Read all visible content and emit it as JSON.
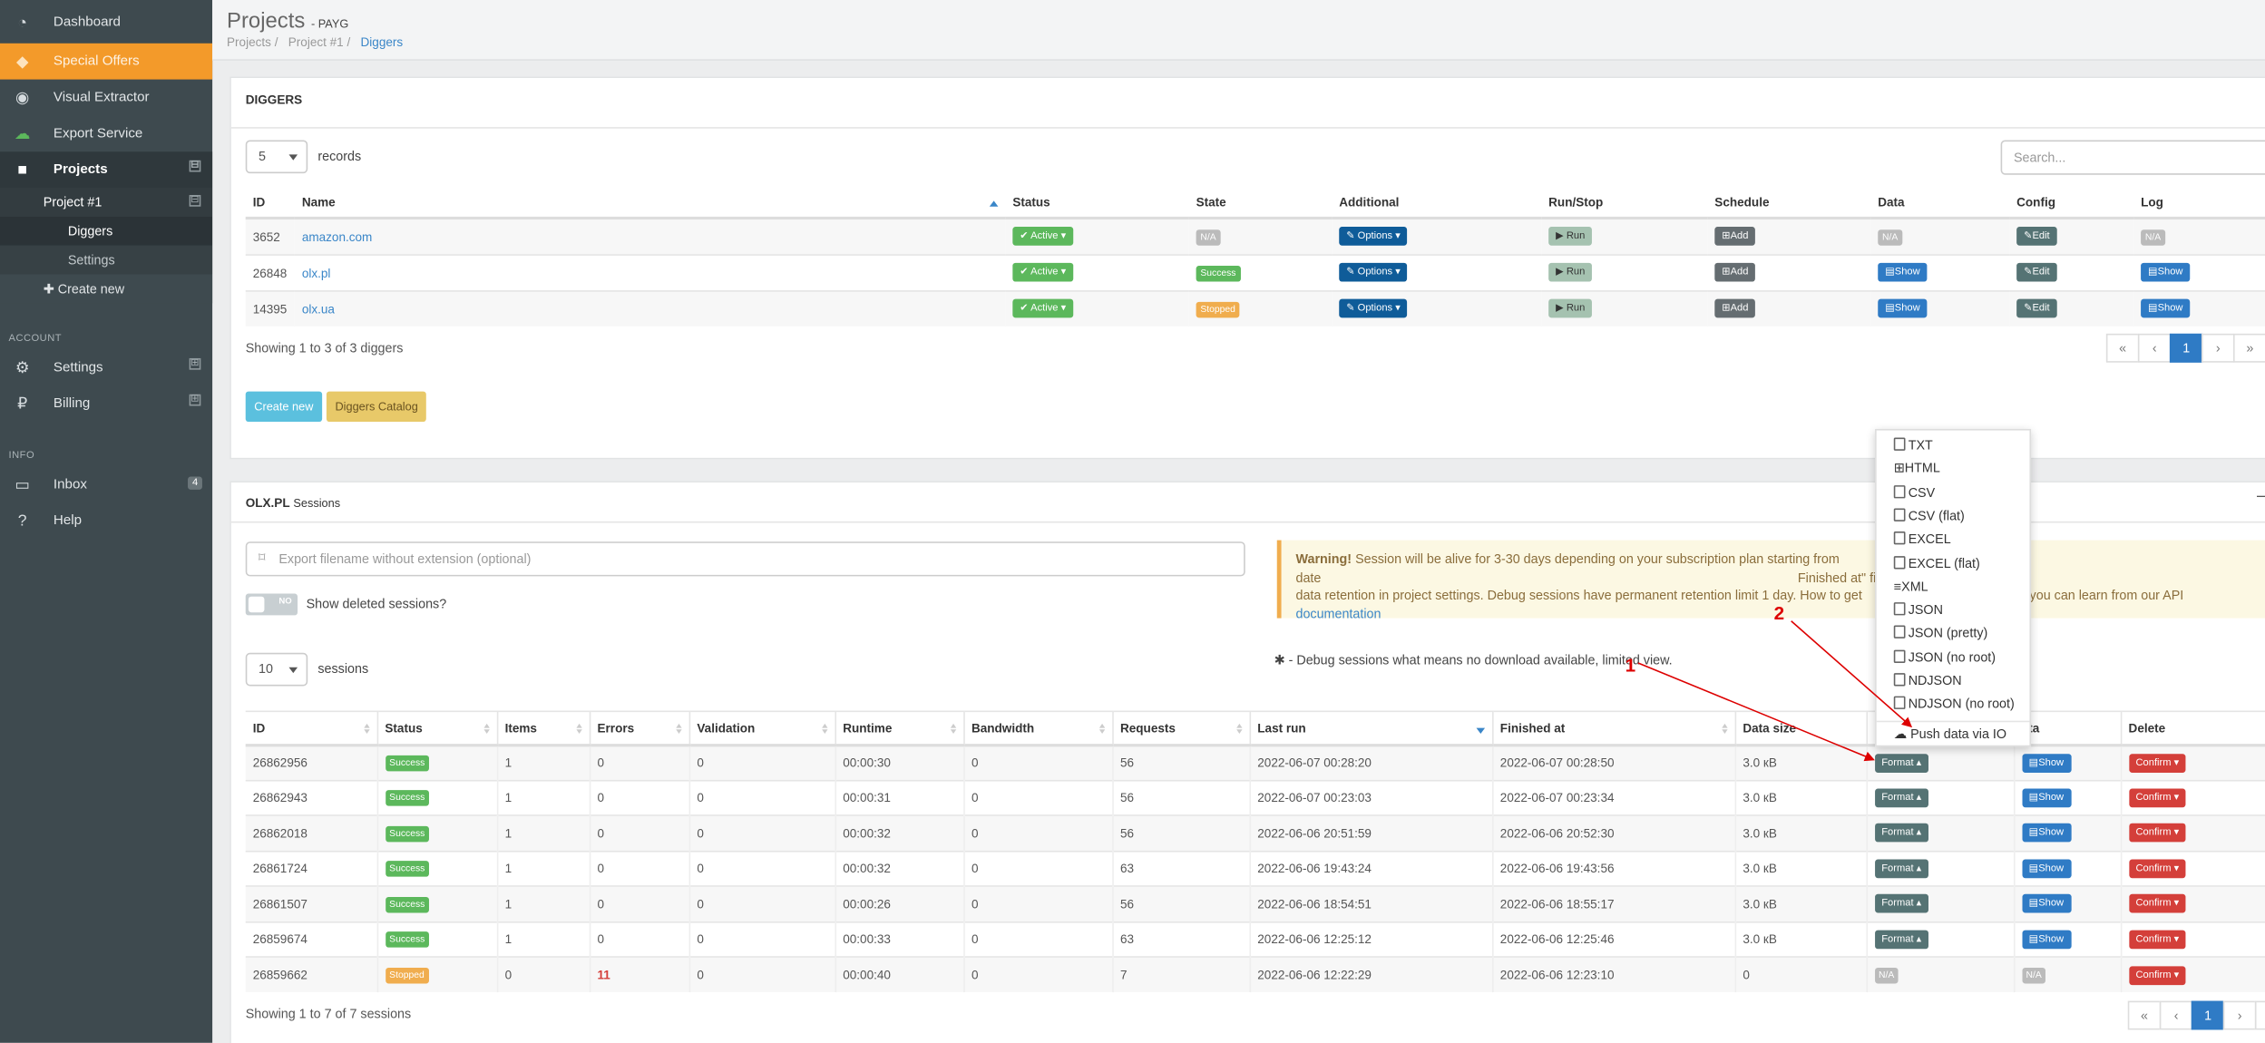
{
  "sidebar": {
    "items": [
      {
        "label": "Dashboard",
        "icon": "dashboard-icon"
      },
      {
        "label": "Special Offers",
        "icon": "diamond-icon"
      },
      {
        "label": "Visual Extractor",
        "icon": "chrome-icon"
      },
      {
        "label": "Export Service",
        "icon": "cloud-upload-icon"
      },
      {
        "label": "Projects",
        "icon": "briefcase-icon"
      }
    ],
    "project": "Project #1",
    "project_items": [
      "Diggers",
      "Settings"
    ],
    "create_new": "Create new",
    "account_header": "ACCOUNT",
    "account_items": [
      {
        "label": "Settings",
        "icon": "gears-icon"
      },
      {
        "label": "Billing",
        "icon": "ruble-icon"
      }
    ],
    "info_header": "INFO",
    "info_items": [
      {
        "label": "Inbox",
        "icon": "inbox-icon",
        "badge": "4"
      },
      {
        "label": "Help",
        "icon": "question-icon"
      }
    ],
    "toggle_minus": "⊟",
    "toggle_plus": "⊞"
  },
  "header": {
    "title": "Projects",
    "subtitle": "- PAYG",
    "breadcrumb": [
      "Projects",
      "Project #1",
      "Diggers"
    ]
  },
  "diggers": {
    "title": "DIGGERS",
    "records_select": "5",
    "records_label": "records",
    "search_placeholder": "Search...",
    "columns": [
      "ID",
      "Name",
      "Status",
      "State",
      "Additional",
      "Run/Stop",
      "Schedule",
      "Data",
      "Config",
      "Log"
    ],
    "rows": [
      {
        "id": "3652",
        "name": "amazon.com",
        "status": "Active",
        "state": "N/A",
        "additional": "Options",
        "run": "Run",
        "schedule": "Add",
        "data": "N/A",
        "config": "Edit",
        "log": "N/A"
      },
      {
        "id": "26848",
        "name": "olx.pl",
        "status": "Active",
        "state": "Success",
        "additional": "Options",
        "run": "Run",
        "schedule": "Add",
        "data": "Show",
        "config": "Edit",
        "log": "Show"
      },
      {
        "id": "14395",
        "name": "olx.ua",
        "status": "Active",
        "state": "Stopped",
        "additional": "Options",
        "run": "Run",
        "schedule": "Add",
        "data": "Show",
        "config": "Edit",
        "log": "Show"
      }
    ],
    "showing": "Showing 1 to 3 of 3 diggers",
    "pagination": [
      "«",
      "‹",
      "1",
      "›",
      "»"
    ],
    "create_new": "Create new",
    "catalog": "Diggers Catalog"
  },
  "sessions": {
    "title": "OLX.PL",
    "title_suffix": "Sessions",
    "export_placeholder": "Export filename without extension (optional)",
    "toggle_label": "NO",
    "show_deleted": "Show deleted sessions?",
    "warning_bold": "Warning!",
    "warning_text_1": "Session will be alive for 3-30 days depending on your subscription plan starting from date",
    "warning_text_2": "Finished at\" field. You may change",
    "warning_text_3": "data retention in project settings. Debug sessions have permanent retention limit 1 day. How to get",
    "warning_text_4": "you can learn from our API",
    "warning_link": "documentation",
    "sessions_select": "10",
    "sessions_label": "sessions",
    "debug_note": "- Debug sessions what means no download available, limited view.",
    "columns": [
      "ID",
      "Status",
      "Items",
      "Errors",
      "Validation",
      "Runtime",
      "Bandwidth",
      "Requests",
      "Last run",
      "Finished at",
      "Data size",
      "",
      "ata",
      "Delete"
    ],
    "rows": [
      {
        "id": "26862956",
        "status": "Success",
        "items": "1",
        "errors": "0",
        "validation": "0",
        "runtime": "00:00:30",
        "bandwidth": "0",
        "requests": "56",
        "last_run": "2022-06-07 00:28:20",
        "finished": "2022-06-07 00:28:50",
        "size": "3.0 кB",
        "format": "Format",
        "data": "Show",
        "del": "Confirm"
      },
      {
        "id": "26862943",
        "status": "Success",
        "items": "1",
        "errors": "0",
        "validation": "0",
        "runtime": "00:00:31",
        "bandwidth": "0",
        "requests": "56",
        "last_run": "2022-06-07 00:23:03",
        "finished": "2022-06-07 00:23:34",
        "size": "3.0 кB",
        "format": "Format",
        "data": "Show",
        "del": "Confirm"
      },
      {
        "id": "26862018",
        "status": "Success",
        "items": "1",
        "errors": "0",
        "validation": "0",
        "runtime": "00:00:32",
        "bandwidth": "0",
        "requests": "56",
        "last_run": "2022-06-06 20:51:59",
        "finished": "2022-06-06 20:52:30",
        "size": "3.0 кB",
        "format": "Format",
        "data": "Show",
        "del": "Confirm"
      },
      {
        "id": "26861724",
        "status": "Success",
        "items": "1",
        "errors": "0",
        "validation": "0",
        "runtime": "00:00:32",
        "bandwidth": "0",
        "requests": "63",
        "last_run": "2022-06-06 19:43:24",
        "finished": "2022-06-06 19:43:56",
        "size": "3.0 кB",
        "format": "Format",
        "data": "Show",
        "del": "Confirm"
      },
      {
        "id": "26861507",
        "status": "Success",
        "items": "1",
        "errors": "0",
        "validation": "0",
        "runtime": "00:00:26",
        "bandwidth": "0",
        "requests": "56",
        "last_run": "2022-06-06 18:54:51",
        "finished": "2022-06-06 18:55:17",
        "size": "3.0 кB",
        "format": "Format",
        "data": "Show",
        "del": "Confirm"
      },
      {
        "id": "26859674",
        "status": "Success",
        "items": "1",
        "errors": "0",
        "validation": "0",
        "runtime": "00:00:33",
        "bandwidth": "0",
        "requests": "63",
        "last_run": "2022-06-06 12:25:12",
        "finished": "2022-06-06 12:25:46",
        "size": "3.0 кB",
        "format": "Format",
        "data": "Show",
        "del": "Confirm"
      },
      {
        "id": "26859662",
        "status": "Stopped",
        "items": "0",
        "errors": "11",
        "validation": "0",
        "runtime": "00:00:40",
        "bandwidth": "0",
        "requests": "7",
        "last_run": "2022-06-06 12:22:29",
        "finished": "2022-06-06 12:23:10",
        "size": "0",
        "format": "N/A",
        "data": "N/A",
        "del": "Confirm"
      }
    ],
    "showing": "Showing 1 to 7 of 7 sessions",
    "pagination": [
      "«",
      "‹",
      "1",
      "›",
      "»"
    ]
  },
  "format_menu": [
    "TXT",
    "HTML",
    "CSV",
    "CSV (flat)",
    "EXCEL",
    "EXCEL (flat)",
    "XML",
    "JSON",
    "JSON (pretty)",
    "JSON (no root)",
    "NDJSON",
    "NDJSON (no root)"
  ],
  "push_label": "Push data via IO",
  "annotations": [
    "1",
    "2"
  ],
  "colors": {
    "sidebar": "#3e4a4f",
    "accent": "#f39a2a",
    "success": "#5cb85c",
    "primary": "#2f7bc5",
    "danger": "#d43f3a",
    "annotation": "#d00"
  }
}
